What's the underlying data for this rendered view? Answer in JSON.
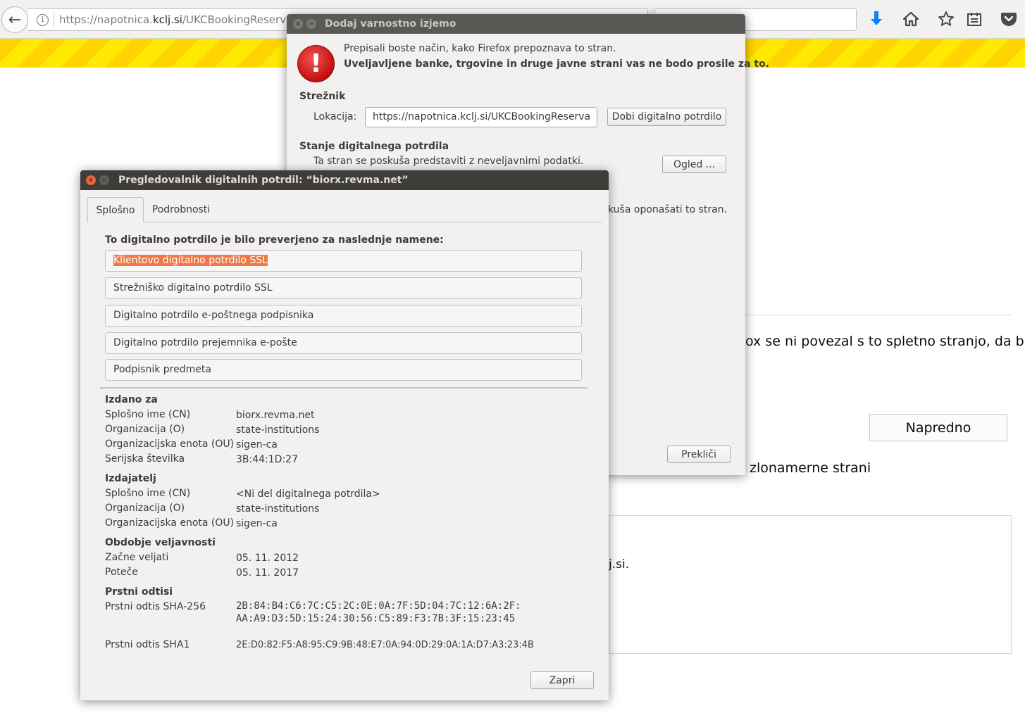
{
  "browser": {
    "url_prefix": "https://napotnica.",
    "url_domain": "kclj.si",
    "url_path": "/UKCBookingReservati",
    "icons": [
      "back-arrow-icon",
      "info-icon",
      "download-icon",
      "home-icon",
      "bookmark-star-icon",
      "reading-list-icon",
      "pocket-icon"
    ]
  },
  "background_page": {
    "text_1": "ox se ni povezal s to spletno stranjo, da bi",
    "advanced_button": "Napredno",
    "text_2": "zlonamerne strani",
    "box_text": "j.si."
  },
  "exception_dialog": {
    "title": "Dodaj varnostno izjemo",
    "warning_line_1": "Prepisali boste način, kako Firefox prepoznava to stran.",
    "warning_line_2": "Uveljavljene banke, trgovine in druge javne strani vas ne bodo prosile za to.",
    "server_heading": "Strežnik",
    "location_label": "Lokacija:",
    "location_value": "https://napotnica.kclj.si/UKCBookingReserva",
    "get_cert_button": "Dobi digitalno potrdilo",
    "status_heading": "Stanje digitalnega potrdila",
    "status_text": "Ta stran se poskuša predstaviti z neveljavnimi podatki.",
    "view_button": "Ogled ...",
    "partial_text": "kuša oponašati to stran.",
    "cancel_button": "Prekliči"
  },
  "cert_viewer": {
    "title": "Pregledovalnik digitalnih potrdil: “biorx.revma.net”",
    "tabs": [
      "Splošno",
      "Podrobnosti"
    ],
    "verified_heading": "To digitalno potrdilo je bilo preverjeno za naslednje namene:",
    "purposes": [
      "Klientovo digitalno potrdilo SSL",
      "Strežniško digitalno potrdilo SSL",
      "Digitalno potrdilo e-poštnega podpisnika",
      "Digitalno potrdilo prejemnika e-pošte",
      "Podpisnik predmeta"
    ],
    "issued_to": {
      "heading": "Izdano za",
      "rows": [
        {
          "label": "Splošno ime (CN)",
          "value": "biorx.revma.net"
        },
        {
          "label": "Organizacija (O)",
          "value": "state-institutions"
        },
        {
          "label": "Organizacijska enota (OU)",
          "value": "sigen-ca"
        },
        {
          "label": "Serijska številka",
          "value": "3B:44:1D:27"
        }
      ]
    },
    "issuer": {
      "heading": "Izdajatelj",
      "rows": [
        {
          "label": "Splošno ime (CN)",
          "value": "<Ni del digitalnega potrdila>"
        },
        {
          "label": "Organizacija (O)",
          "value": "state-institutions"
        },
        {
          "label": "Organizacijska enota (OU)",
          "value": "sigen-ca"
        }
      ]
    },
    "validity": {
      "heading": "Obdobje veljavnosti",
      "rows": [
        {
          "label": "Začne veljati",
          "value": "05. 11. 2012"
        },
        {
          "label": "Poteče",
          "value": "05. 11. 2017"
        }
      ]
    },
    "fingerprints": {
      "heading": "Prstni odtisi",
      "sha256_label": "Prstni odtis SHA-256",
      "sha256_line_1": "2B:84:B4:C6:7C:C5:2C:0E:0A:7F:5D:04:7C:12:6A:2F:",
      "sha256_line_2": "AA:A9:D3:5D:15:24:30:56:C5:89:F3:7B:3F:15:23:45",
      "sha1_label": "Prstni odtis SHA1",
      "sha1_value": "2E:D0:82:F5:A8:95:C9:9B:48:E7:0A:94:0D:29:0A:1A:D7:A3:23:4B"
    },
    "close_button": "Zapri"
  }
}
